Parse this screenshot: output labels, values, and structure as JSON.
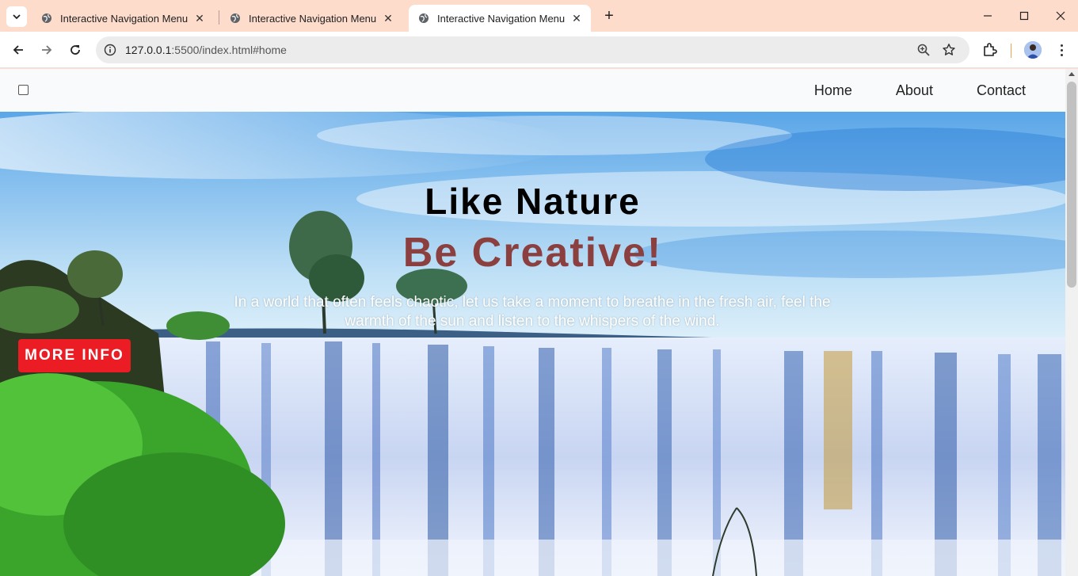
{
  "browser": {
    "tabs": [
      {
        "title": "Interactive Navigation Menu",
        "active": false
      },
      {
        "title": "Interactive Navigation Menu",
        "active": false
      },
      {
        "title": "Interactive Navigation Menu",
        "active": true
      }
    ],
    "url_host": "127.0.0.1",
    "url_path": ":5500/index.html#home",
    "icons": [
      "tab-search-icon",
      "globe-icon",
      "close-icon",
      "plus-icon",
      "minimize-icon",
      "maximize-icon",
      "close-window-icon",
      "back-icon",
      "forward-icon",
      "reload-icon",
      "info-icon",
      "zoom-icon",
      "star-icon",
      "extensions-icon",
      "avatar",
      "menu-icon"
    ]
  },
  "site": {
    "nav": {
      "checkbox_checked": false,
      "links": [
        {
          "label": "Home"
        },
        {
          "label": "About"
        },
        {
          "label": "Contact"
        }
      ]
    },
    "hero": {
      "title": "Like Nature",
      "subtitle": "Be Creative!",
      "description": "In a world that often feels chaotic, let us take a moment to breathe in the fresh air, feel the warmth of the sun and listen to the whispers of the wind.",
      "button_label": "MORE INFO"
    },
    "colors": {
      "title": "#000000",
      "subtitle": "#8b3f3f",
      "button": "#ec1c24",
      "tabstrip": "#fddccb"
    }
  }
}
